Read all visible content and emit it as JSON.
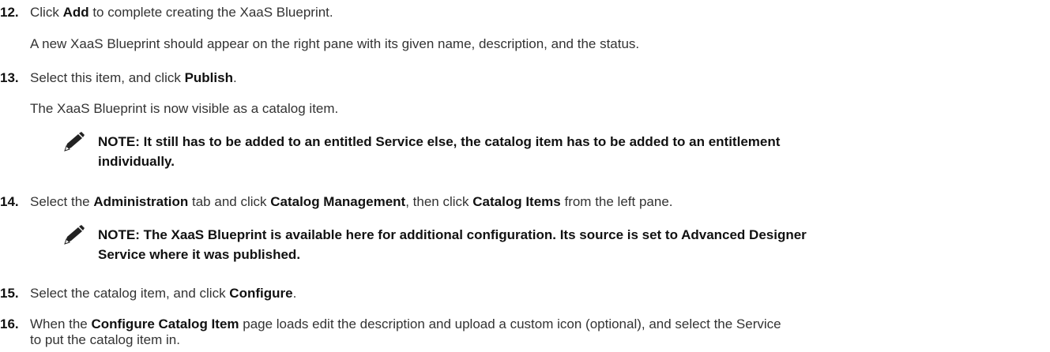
{
  "steps": [
    {
      "num": "12.",
      "segments": [
        {
          "t": "Click ",
          "b": false
        },
        {
          "t": "Add",
          "b": true
        },
        {
          "t": " to complete creating the XaaS Blueprint.",
          "b": false
        }
      ]
    },
    {
      "num": "13.",
      "segments": [
        {
          "t": "Select this item, and click ",
          "b": false
        },
        {
          "t": "Publish",
          "b": true
        },
        {
          "t": ".",
          "b": false
        }
      ]
    },
    {
      "num": "14.",
      "segments": [
        {
          "t": "Select the ",
          "b": false
        },
        {
          "t": "Administration",
          "b": true
        },
        {
          "t": " tab and click ",
          "b": false
        },
        {
          "t": "Catalog Management",
          "b": true
        },
        {
          "t": ", then click ",
          "b": false
        },
        {
          "t": "Catalog Items",
          "b": true
        },
        {
          "t": " from the left pane.",
          "b": false
        }
      ]
    },
    {
      "num": "15.",
      "segments": [
        {
          "t": "Select the catalog item, and click ",
          "b": false
        },
        {
          "t": "Configure",
          "b": true
        },
        {
          "t": ".",
          "b": false
        }
      ]
    },
    {
      "num": "16.",
      "segments": [
        {
          "t": "When the ",
          "b": false
        },
        {
          "t": "Configure Catalog Item",
          "b": true
        },
        {
          "t": " page loads edit the description and upload a custom icon (optional), and select the Service",
          "b": false
        },
        {
          "t": "to put the catalog item in.",
          "b": false,
          "br": true
        }
      ]
    }
  ],
  "sub": {
    "s12": "A new XaaS Blueprint should appear on the right pane with its given name, description, and the status.",
    "s13": "The XaaS Blueprint is now visible as a catalog item."
  },
  "notes": {
    "n1_line1": "NOTE: It still has to be added to an entitled Service else, the catalog item has to be added to an entitlement",
    "n1_line2": "individually.",
    "n2_line1": "NOTE: The XaaS Blueprint is available here for additional configuration. Its source is set to Advanced Designer",
    "n2_line2": "Service where it was published."
  },
  "icons": {
    "note": "note-pencil-icon"
  }
}
